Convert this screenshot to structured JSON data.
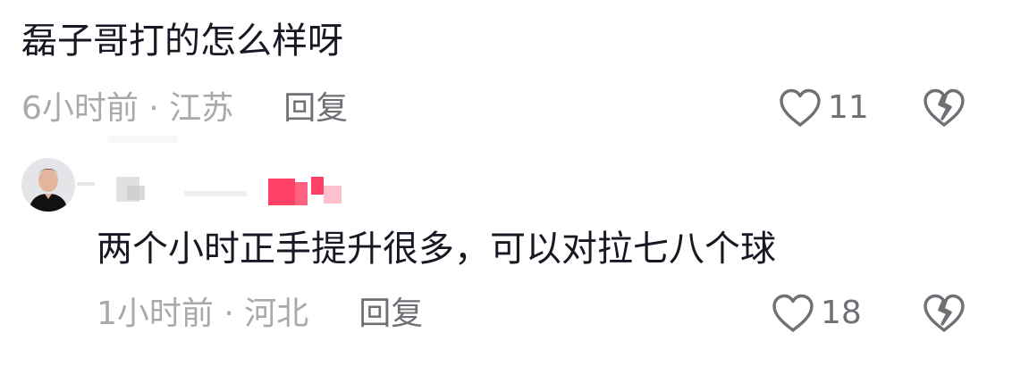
{
  "comments": [
    {
      "text": "磊子哥打的怎么样呀",
      "time_location": "6小时前 · 江苏",
      "reply_label": "回复",
      "likes": "11"
    },
    {
      "text": "两个小时正手提升很多，可以对拉七八个球",
      "time_location": "1小时前 · 河北",
      "reply_label": "回复",
      "likes": "18"
    }
  ],
  "colors": {
    "primary_text": "#161823",
    "secondary_text": "#a8a9ad",
    "action_text": "#6e7075",
    "icon_stroke": "#6e7075",
    "censor_pink": "#fe2c55"
  },
  "icons": {
    "like": "heart-outline-icon",
    "dislike": "broken-heart-icon"
  }
}
